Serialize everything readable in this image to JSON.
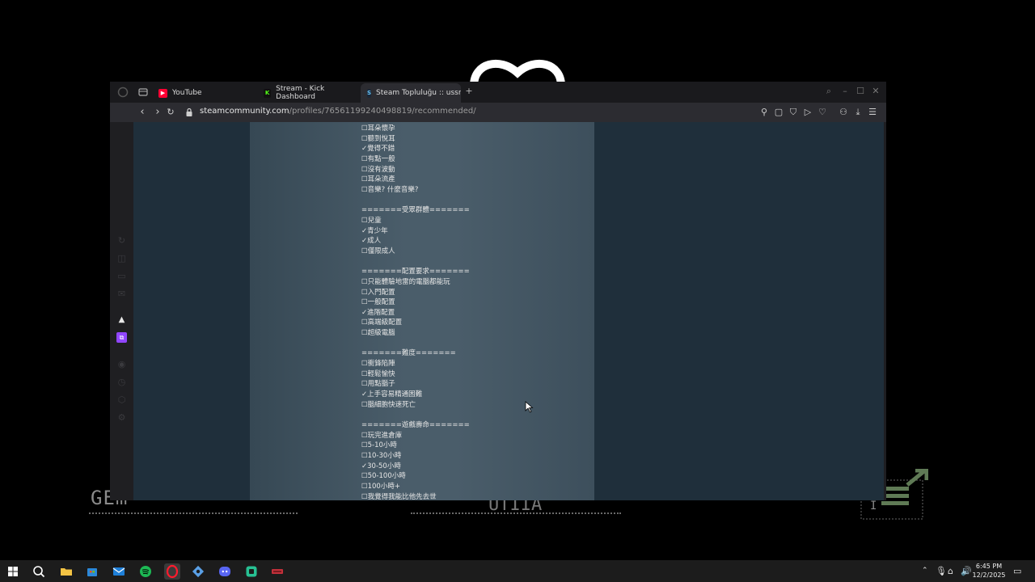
{
  "browser": {
    "tabs": [
      {
        "label": "YouTube",
        "icon": "youtube-icon",
        "color": "#ff0033"
      },
      {
        "label": "Stream - Kick Dashboard",
        "icon": "kick-icon",
        "color": "#53fc18"
      },
      {
        "label": "Steam Topluluğu :: ussrhk",
        "icon": "steam-icon",
        "color": "#1b9fd8",
        "active": true
      }
    ],
    "new_tab": "+",
    "url_host": "steamcommunity.com",
    "url_path": "/profiles/76561199240498819/recommended/"
  },
  "review_text": "☐耳朵懷孕\n☐聽到悅耳\n✓覺得不錯\n☐有點一般\n☐沒有波動\n☐耳朵流產\n☐音樂? 什麼音樂?\n\n=======受眾群體=======\n☐兒童\n✓青少年\n✓成人\n☐僅限成人\n\n=======配置要求=======\n☐只能體驗地雷的電腦都能玩\n☐入門配置\n☐一般配置\n✓進階配置\n☐高端級配置\n☐超級電腦\n\n=======難度=======\n☐衝鋒陷陣\n☐輕鬆愉快\n☐用點腦子\n✓上手容易精通困難\n☐腦細胞快速死亡\n\n=======遊戲壽命=======\n☐玩完進倉庫\n☐5-10小時\n☐10-30小時\n✓30-50小時\n☐50-100小時\n☐100小時+\n☐我覺得我能比他先去世",
  "background": {
    "left_text": "GEm",
    "mid_text": "UTIIA",
    "corner_text": "I"
  },
  "taskbar": {
    "clock_time": "6:45 PM",
    "clock_date": "12/2/2025"
  },
  "colors": {
    "accent": "#ff1b2d",
    "spotify": "#1db954",
    "discord": "#5865f2"
  }
}
